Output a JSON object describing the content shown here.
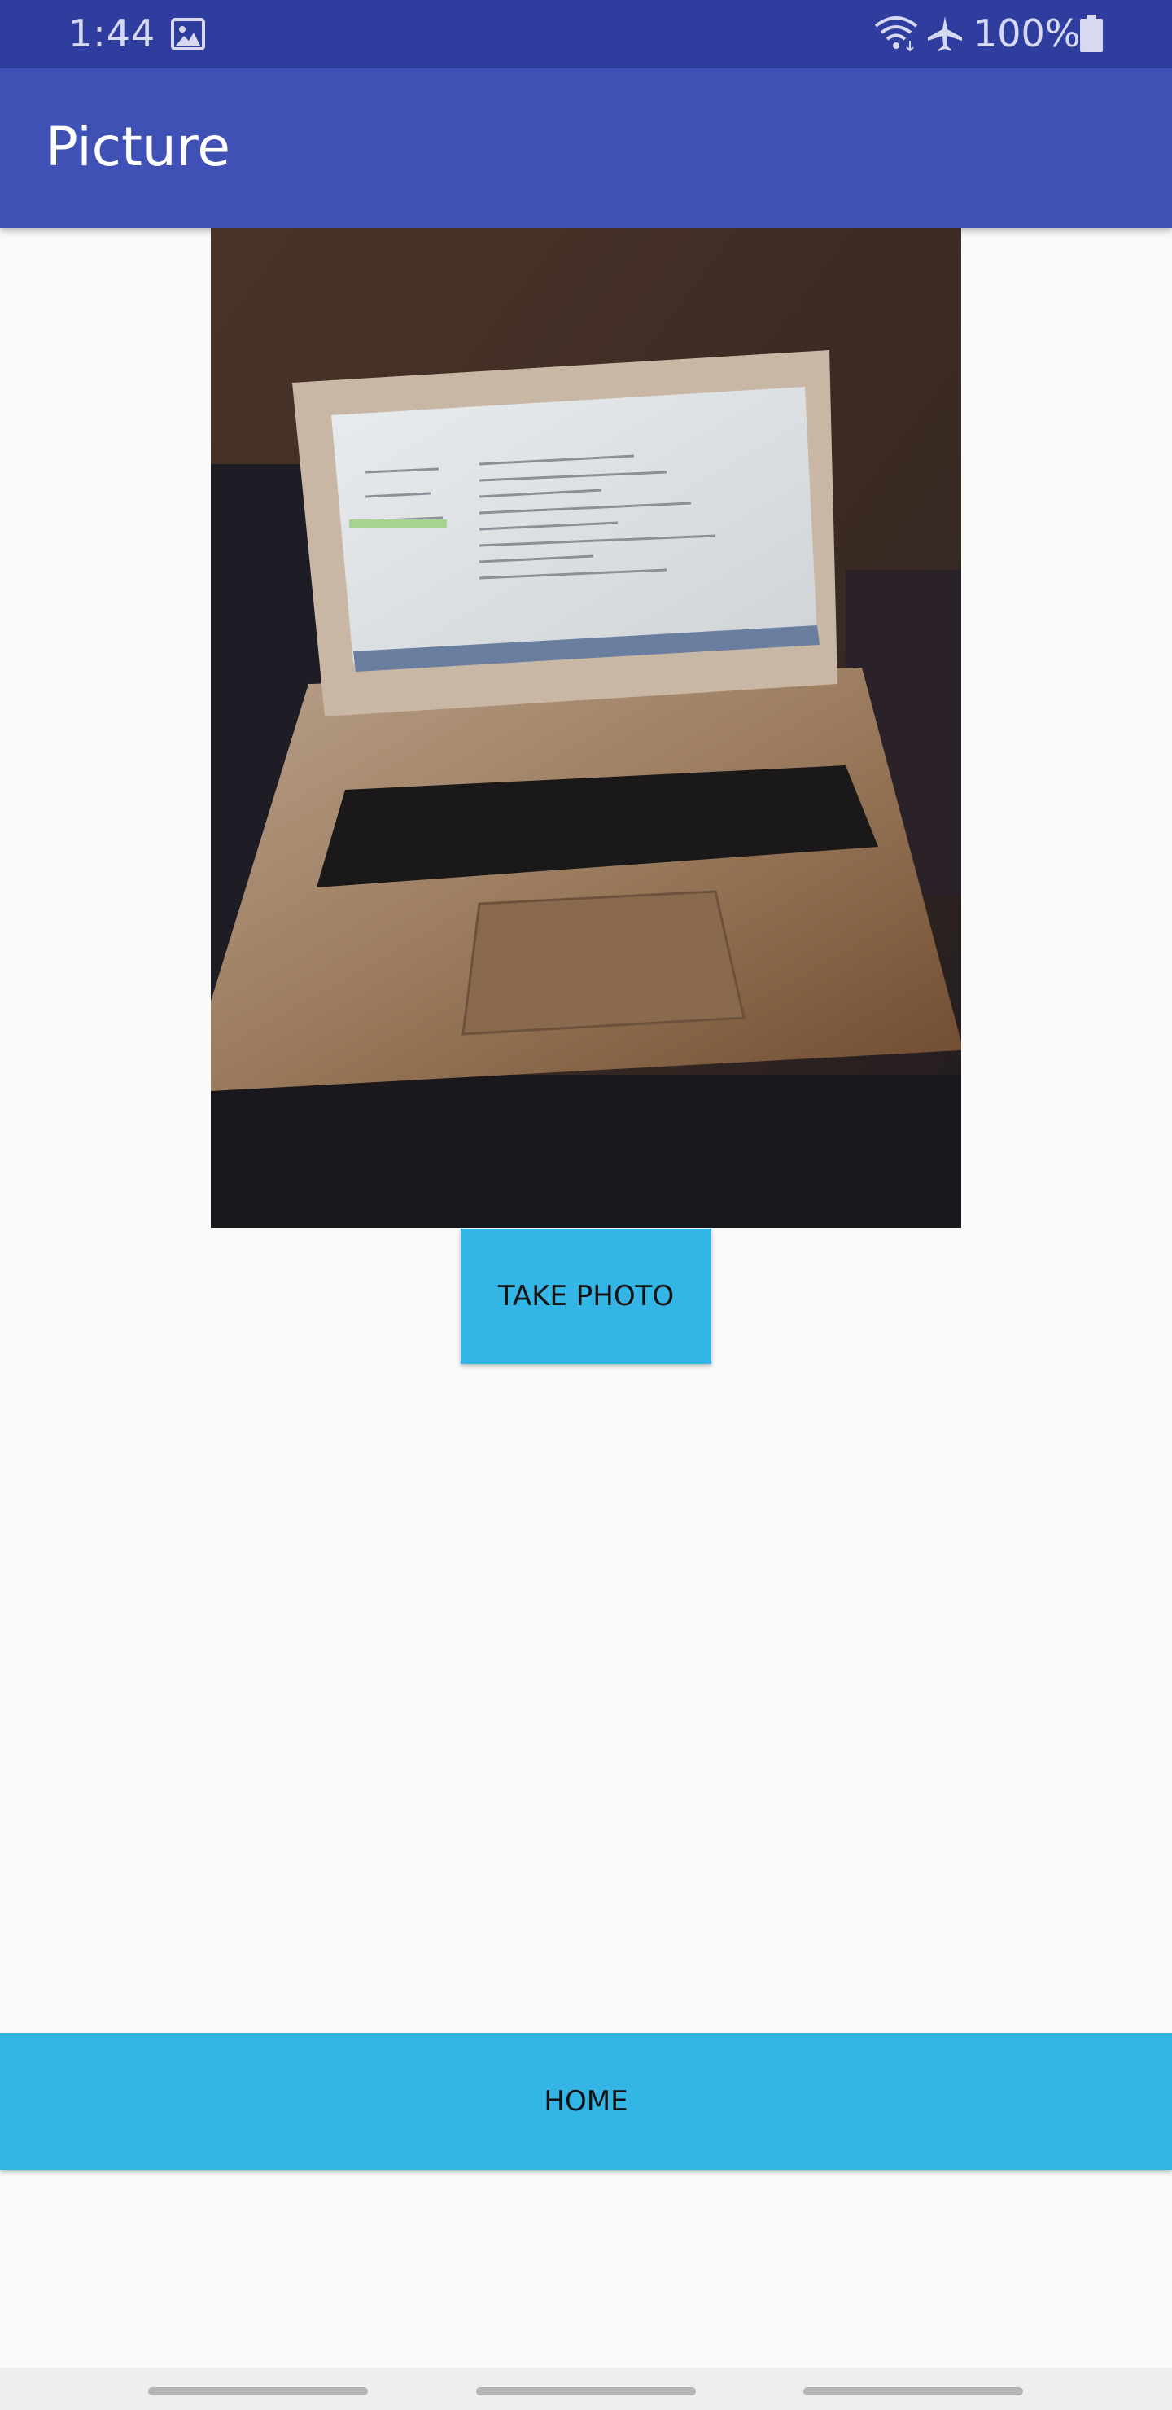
{
  "status_bar": {
    "time": "1:44",
    "battery_text": "100%",
    "icons": [
      "gallery-icon",
      "wifi-icon",
      "airplane-icon",
      "battery-icon"
    ]
  },
  "app_bar": {
    "title": "Picture",
    "color": "#3f51b5"
  },
  "photo": {
    "subject": "laptop-photo"
  },
  "buttons": {
    "take_photo": "TAKE PHOTO",
    "home": "HOME",
    "color": "#33b5e5"
  },
  "nav_bar": {
    "handles": 3
  }
}
